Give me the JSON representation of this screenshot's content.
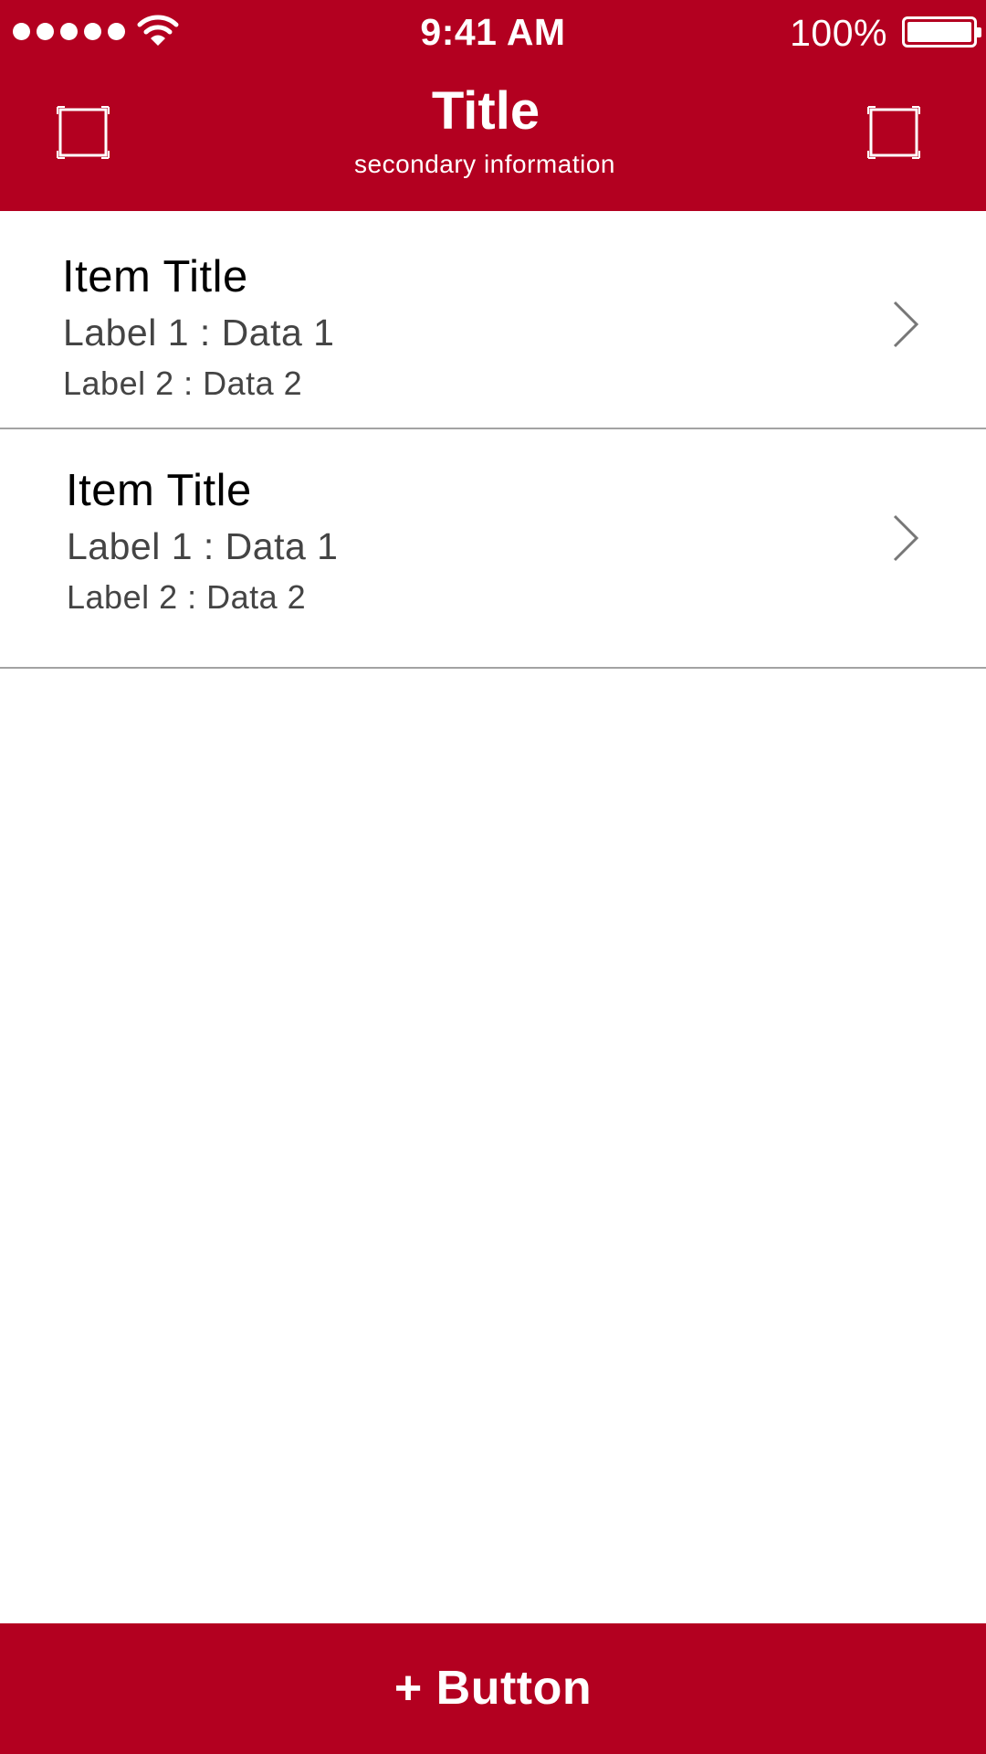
{
  "status_bar": {
    "time": "9:41 AM",
    "battery_percent": "100%",
    "signal_bars": 5,
    "battery_level": 1.0,
    "icons": [
      "signal-icon",
      "wifi-icon",
      "battery-icon"
    ]
  },
  "nav": {
    "title": "Title",
    "subtitle": "secondary information",
    "left_icon": "square-frame-icon",
    "right_icon": "square-frame-icon"
  },
  "list": {
    "items": [
      {
        "title": "Item Title",
        "line1": "Label 1 : Data 1",
        "line2": "Label 2 : Data 2",
        "icon": "chevron-right-icon"
      },
      {
        "title": "Item Title",
        "line1": "Label 1 : Data 1",
        "line2": "Label 2 : Data 2",
        "icon": "chevron-right-icon"
      }
    ]
  },
  "bottom_button": {
    "label": "+ Button"
  },
  "colors": {
    "brand": "#b30020",
    "background": "#ffffff",
    "divider": "#a3a3a3",
    "title_text": "#000000",
    "secondary_text": "#444444",
    "chevron": "#777777"
  }
}
